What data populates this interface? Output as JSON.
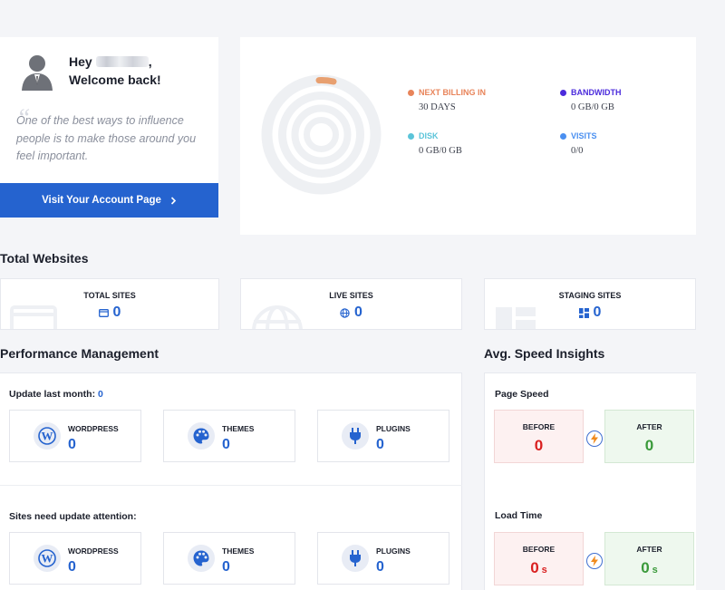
{
  "welcome": {
    "greeting": "Hey",
    "welcome_back": "Welcome back!",
    "quote": "One of the best ways to influence people is to make those around you feel important.",
    "account_button": "Visit Your Account Page",
    "account_button_icon": "chevron-right-icon"
  },
  "usage": {
    "next_billing": {
      "label": "NEXT BILLING IN",
      "value": "30 DAYS",
      "color": "#e8845a"
    },
    "bandwidth": {
      "label": "BANDWIDTH",
      "value": "0 GB/0 GB",
      "color": "#4b2bdc"
    },
    "disk": {
      "label": "DISK",
      "value": "0 GB/0 GB",
      "color": "#5bc4d9"
    },
    "visits": {
      "label": "VISITS",
      "value": "0/0",
      "color": "#4a8ff0"
    },
    "ring_color": "#eef0f3",
    "progress_color": "#e8a070"
  },
  "total_websites": {
    "title": "Total Websites",
    "cards": [
      {
        "label": "TOTAL SITES",
        "count": "0",
        "icon": "browser-window-icon"
      },
      {
        "label": "LIVE SITES",
        "count": "0",
        "icon": "globe-icon"
      },
      {
        "label": "STAGING SITES",
        "count": "0",
        "icon": "dashboard-grid-icon"
      }
    ]
  },
  "performance": {
    "title": "Performance Management",
    "update_last_month": {
      "label": "Update last month:",
      "count": "0"
    },
    "sites_need_update": {
      "label": "Sites need update attention:"
    },
    "items_top": [
      {
        "name": "WORDPRESS",
        "count": "0",
        "icon": "wordpress-icon"
      },
      {
        "name": "THEMES",
        "count": "0",
        "icon": "palette-icon"
      },
      {
        "name": "PLUGINS",
        "count": "0",
        "icon": "plug-icon"
      }
    ],
    "items_bottom": [
      {
        "name": "WORDPRESS",
        "count": "0",
        "icon": "wordpress-icon"
      },
      {
        "name": "THEMES",
        "count": "0",
        "icon": "palette-icon"
      },
      {
        "name": "PLUGINS",
        "count": "0",
        "icon": "plug-icon"
      }
    ]
  },
  "speed": {
    "title": "Avg. Speed Insights",
    "page_speed": {
      "label": "Page Speed",
      "before_label": "BEFORE",
      "before": "0",
      "after_label": "AFTER",
      "after": "0"
    },
    "load_time": {
      "label": "Load Time",
      "before_label": "BEFORE",
      "before": "0",
      "before_unit": "s",
      "after_label": "AFTER",
      "after": "0",
      "after_unit": "s"
    }
  }
}
